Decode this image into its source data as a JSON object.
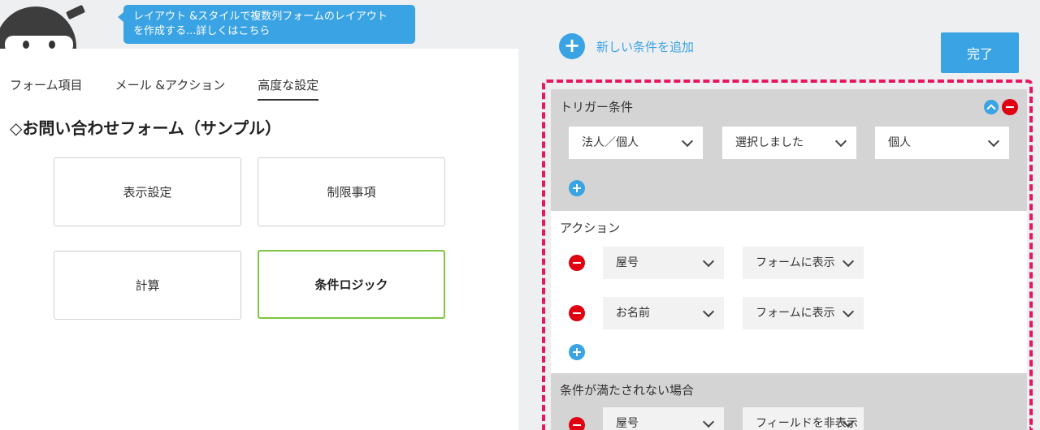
{
  "tooltip": {
    "line1": "レイアウト &スタイルで複数列フォームのレイアウト",
    "line2": "を作成する...詳しくはこちら"
  },
  "tabs": [
    {
      "label": "フォーム項目"
    },
    {
      "label": "メール &アクション"
    },
    {
      "label": "高度な設定"
    }
  ],
  "form_title": "◇お問い合わせフォーム（サンプル）",
  "cards": {
    "display": "表示設定",
    "restriction": "制限事項",
    "calculation": "計算",
    "conditional": "条件ロジック"
  },
  "add_condition": {
    "label": "新しい条件を追加",
    "icon": "plus-circle-icon"
  },
  "done_label": "完了",
  "trigger": {
    "title": "トリガー条件",
    "field": "法人／個人",
    "operator": "選択しました",
    "value": "個人"
  },
  "action": {
    "title": "アクション",
    "rows": [
      {
        "field": "屋号",
        "action": "フォームに表示"
      },
      {
        "field": "お名前",
        "action": "フォームに表示"
      }
    ]
  },
  "unmet": {
    "title": "条件が満たされない場合",
    "field": "屋号",
    "action": "フィールドを非表示"
  },
  "colors": {
    "accent": "#3aa3e3",
    "highlight": "#e8175d",
    "selected": "#7cc540",
    "remove": "#e00012"
  }
}
